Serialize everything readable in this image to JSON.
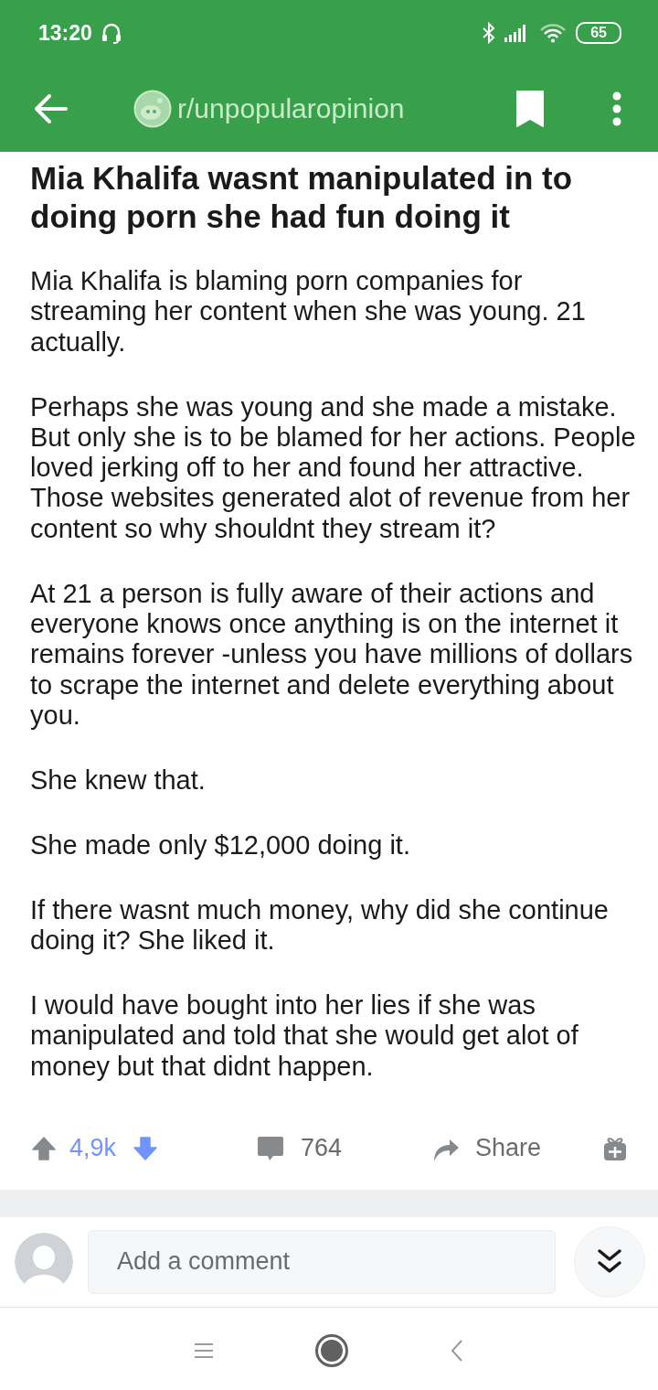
{
  "status_bar": {
    "time": "13:20",
    "battery": "65"
  },
  "app_bar": {
    "subreddit": "r/unpopularopinion"
  },
  "post": {
    "title": "Mia Khalifa wasnt manipulated in to doing porn she had fun doing it",
    "paragraphs": [
      "Mia Khalifa is blaming porn companies for streaming her content when she was young. 21 actually.",
      "Perhaps she was young and she made a mistake. But only she is to be blamed for her actions. People loved jerking off to her and found her attractive. Those websites generated alot of revenue from her content so why shouldnt they stream it?",
      "At 21 a person is fully aware of their actions and everyone knows once anything is on the internet it remains forever -unless you have millions of dollars to scrape the internet and delete everything about you.",
      "She knew that.",
      "She made only $12,000 doing it.",
      "If there wasnt much money, why did she continue doing it? She liked it.",
      "I would have bought into her lies if she was manipulated and told that she would get alot of money but that didnt happen."
    ]
  },
  "actions": {
    "upvoted": false,
    "downvoted": true,
    "score": "4,9k",
    "comments": "764",
    "share": "Share"
  },
  "comment_bar": {
    "placeholder": "Add a comment"
  }
}
